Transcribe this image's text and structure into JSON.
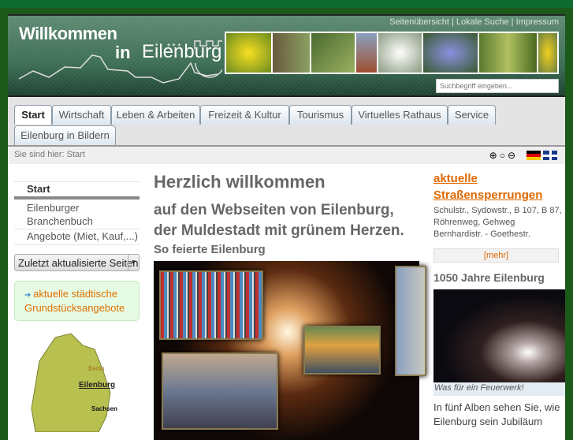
{
  "header": {
    "logo_line1": "Willkommen",
    "logo_in": "in",
    "logo_city": "Eilenburg",
    "top_links": [
      "Seitenübersicht",
      "Lokale Suche",
      "Impressum"
    ],
    "search_placeholder": "Suchbegriff eingeben..."
  },
  "nav": {
    "tabs": [
      "Start",
      "Wirtschaft",
      "Leben & Arbeiten",
      "Freizeit & Kultur",
      "Tourismus",
      "Virtuelles Rathaus",
      "Service",
      "Eilenburg in Bildern"
    ]
  },
  "breadcrumb": "Sie sind hier: Start",
  "sidebar": {
    "items": [
      "Start",
      "Eilenburger Branchenbuch",
      "Angebote (Miet, Kauf,...)"
    ],
    "select_value": "Zuletzt aktualisierte Seiten",
    "promo": "aktuelle städtische Grundstücksangebote",
    "map_labels": [
      "Berlin",
      "Eilenburg",
      "Sachsen"
    ]
  },
  "main": {
    "title": "Herzlich willkommen",
    "subtitle_1": "auf den Webseiten von Eilenburg,",
    "subtitle_2": "der Muldestadt mit grünem Herzen.",
    "section": "So feierte Eilenburg"
  },
  "right": {
    "link_1": "aktuelle",
    "link_2": "Straßensperrungen",
    "text_1": "Schulstr., Sydowstr., B 107, B 87,",
    "text_2": "Röhrenweg, Gehweg",
    "text_3": "Bernhardistr. - Goethestr.",
    "more": "[mehr]",
    "heading": "1050 Jahre Eilenburg",
    "caption": "Was für ein Feuerwerk!",
    "body_1": "In fünf Alben sehen Sie, wie",
    "body_2": "Eilenburg sein Jubiläum"
  },
  "colors": {
    "accent": "#e06800",
    "frame": "#1c5a1a",
    "header": "#3d6e55"
  }
}
